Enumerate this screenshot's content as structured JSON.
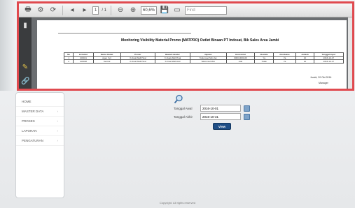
{
  "viewer": {
    "page_current": "1",
    "page_total": "/ 1",
    "zoom": "60,6%",
    "find_placeholder": "Find"
  },
  "document": {
    "title": "Monitoring Visibility Material Promo (MATPRO) Outlet Binaan PT Indosat, Bik Sales Area Jambi",
    "headers": [
      "No",
      "Id Outlet",
      "Nama Outlet",
      "Poster",
      "Bawah Header",
      "Jajaran",
      "Horizontal",
      "Flexible",
      "Pembatas",
      "Jumlah",
      "Tanggal Input"
    ],
    "rows": [
      [
        "1",
        "100021",
        "Agen Xyz",
        "X-Dual-Wall Pinal",
        "X-Dual-Wall Pinal",
        "Telkomsel Mini Jet",
        "0000-0000-00",
        "Ya",
        "Ya",
        "10",
        "2016-10-17"
      ],
      [
        "2",
        "100028",
        "Sentral",
        "X-Dual-Wall Pinal",
        "X-Dual-Wall Add",
        "Telkomsel Mini",
        "Add",
        "Tidak",
        "Ya",
        "10",
        "2016-10-17"
      ]
    ],
    "date_line": "Jambi, 20 Okt 2016",
    "sign_label": "Manager"
  },
  "sidebar": {
    "items": [
      {
        "label": "HOME",
        "chevron": ""
      },
      {
        "label": "MASTER DATA",
        "chevron": "›"
      },
      {
        "label": "PROSES",
        "chevron": "›"
      },
      {
        "label": "LAPORAN",
        "chevron": "›"
      },
      {
        "label": "PENGATURAN",
        "chevron": "›"
      }
    ]
  },
  "form": {
    "start_label": "Tanggal Awal",
    "start_value": "2016-10-01",
    "end_label": "Tanggal Akhir",
    "end_value": "2016-10-31",
    "view_label": "View"
  },
  "footer": {
    "text": "Copyright. All rights reserved"
  },
  "colors": {
    "highlight": "#e04a4f",
    "button": "#1f4e86"
  }
}
